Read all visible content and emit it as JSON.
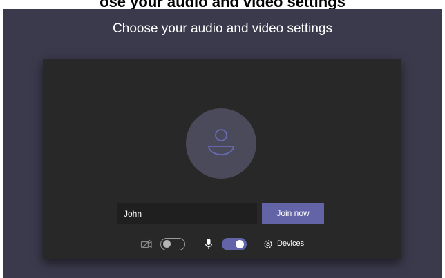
{
  "header": {
    "banner_text": "ose your audio and video settings"
  },
  "main": {
    "title": "Choose your audio and video settings",
    "avatar_icon": "person-icon",
    "name_input": {
      "value": "John",
      "placeholder": ""
    },
    "join_button_label": "Join now"
  },
  "controls": {
    "camera": {
      "icon": "camera-off-icon",
      "enabled": false
    },
    "microphone": {
      "icon": "microphone-icon",
      "enabled": true
    },
    "devices": {
      "icon": "gear-icon",
      "label": "Devices"
    }
  },
  "colors": {
    "background": "#3b3a4c",
    "preview": "#282828",
    "accent": "#6264a7",
    "input": "#1f1f1f",
    "avatar": "#4a4a5a"
  }
}
